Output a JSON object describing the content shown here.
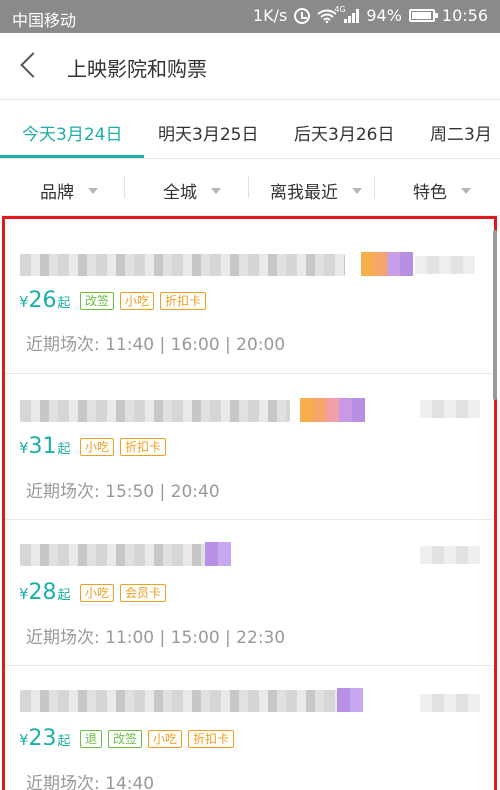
{
  "status_bar": {
    "carrier": "中国移动",
    "speed": "1K/s",
    "network": "4G",
    "battery": "94%",
    "time": "10:56"
  },
  "header": {
    "title": "上映影院和购票"
  },
  "date_tabs": [
    {
      "label": "今天3月24日",
      "active": true
    },
    {
      "label": "明天3月25日",
      "active": false
    },
    {
      "label": "后天3月26日",
      "active": false
    },
    {
      "label": "周二3月",
      "active": false
    }
  ],
  "filters": [
    {
      "label": "品牌"
    },
    {
      "label": "全城"
    },
    {
      "label": "离我最近"
    },
    {
      "label": "特色"
    }
  ],
  "colors": {
    "accent": "#1bb0a5",
    "tag_green": "#6cbd45",
    "tag_orange": "#f0a020",
    "highlight_border": "#e0191e"
  },
  "cinemas": [
    {
      "currency": "¥",
      "price": "26",
      "price_suffix": "起",
      "tags": [
        {
          "text": "改签",
          "color": "green"
        },
        {
          "text": "小吃",
          "color": "orange"
        },
        {
          "text": "折扣卡",
          "color": "orange"
        }
      ],
      "showtimes": "近期场次: 11:40 | 16:00 | 20:00",
      "badge_colors": [
        "#f5b04b",
        "#f7a66b",
        "#c9a0e8",
        "#b78fe3"
      ]
    },
    {
      "currency": "¥",
      "price": "31",
      "price_suffix": "起",
      "tags": [
        {
          "text": "小吃",
          "color": "orange"
        },
        {
          "text": "折扣卡",
          "color": "orange"
        }
      ],
      "showtimes": "近期场次: 15:50 | 20:40",
      "badge_colors": [
        "#f5b04b",
        "#f7a66b",
        "#f2a0a8",
        "#c89ae6",
        "#b78fe3"
      ]
    },
    {
      "currency": "¥",
      "price": "28",
      "price_suffix": "起",
      "tags": [
        {
          "text": "小吃",
          "color": "orange"
        },
        {
          "text": "会员卡",
          "color": "orange"
        }
      ],
      "showtimes": "近期场次: 11:00 | 15:00 | 22:30",
      "badge_colors": [
        "#b890e6",
        "#c8a8ee"
      ]
    },
    {
      "currency": "¥",
      "price": "23",
      "price_suffix": "起",
      "tags": [
        {
          "text": "退",
          "color": "green"
        },
        {
          "text": "改签",
          "color": "green"
        },
        {
          "text": "小吃",
          "color": "orange"
        },
        {
          "text": "折扣卡",
          "color": "orange"
        }
      ],
      "showtimes": "近期场次: 14:40",
      "badge_colors": [
        "#b890e6",
        "#c8a8ee"
      ]
    }
  ]
}
